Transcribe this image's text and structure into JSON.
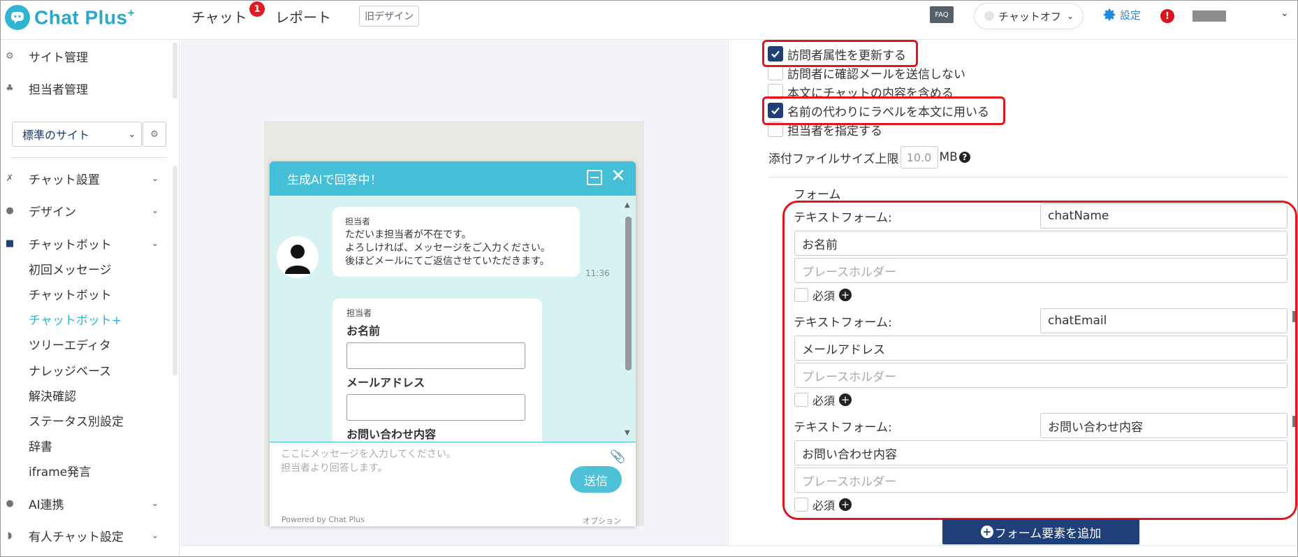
{
  "header": {
    "logo_text": "Chat Plus",
    "logo_sup": "+",
    "nav_chat": "チャット",
    "nav_chat_badge": "1",
    "nav_report": "レポート",
    "old_design": "旧デザイン",
    "faq": "FAQ",
    "chat_status": "チャットオフ",
    "settings": "設定",
    "alert": "!"
  },
  "sidebar": {
    "site_manage": "サイト管理",
    "staff_manage": "担当者管理",
    "site_select": "標準のサイト",
    "sections": {
      "chat_setup": "チャット設置",
      "design": "デザイン",
      "chatbot": "チャットボット",
      "ai": "AI連携",
      "manned": "有人チャット設定"
    },
    "sub": {
      "first_message": "初回メッセージ",
      "chatbot": "チャットボット",
      "chatbot_plus": "チャットボット+",
      "tree_editor": "ツリーエディタ",
      "knowledge": "ナレッジベース",
      "resolution": "解決確認",
      "status_settings": "ステータス別設定",
      "dictionary": "辞書",
      "iframe": "iframe発言"
    }
  },
  "widget": {
    "title": "生成AIで回答中！",
    "bubble1_name": "担当者",
    "bubble1_msg": "ただいま担当者が不在です。\nよろしければ、メッセージをご入力ください。\n後ほどメールにてご返信させていただきます。",
    "bubble1_time": "11:36",
    "bubble2_name": "担当者",
    "field_name": "お名前",
    "field_email": "メールアドレス",
    "field_inquiry": "お問い合わせ内容",
    "input_placeholder": "ここにメッセージを入力してください。\n担当者より回答します。",
    "send": "送信",
    "powered": "Powered by Chat Plus",
    "option": "オプション"
  },
  "settings_panel": {
    "cb_update_attr": "訪問者属性を更新する",
    "cb_no_confirm_mail": "訪問者に確認メールを送信しない",
    "cb_include_chat": "本文にチャットの内容を含める",
    "cb_use_label": "名前の代わりにラベルを本文に用いる",
    "cb_assign_staff": "担当者を指定する",
    "checked": {
      "update_attr": true,
      "no_confirm_mail": false,
      "include_chat": false,
      "use_label": true,
      "assign_staff": false
    },
    "filesize_label": "添付ファイルサイズ上限",
    "filesize_value": "10.0",
    "filesize_unit": "MB",
    "form_title": "フォーム",
    "forms": [
      {
        "type_label": "テキストフォーム:",
        "key": "chatName",
        "label": "お名前",
        "placeholder": "プレースホルダー",
        "required": "必須"
      },
      {
        "type_label": "テキストフォーム:",
        "key": "chatEmail",
        "label": "メールアドレス",
        "placeholder": "プレースホルダー",
        "required": "必須"
      },
      {
        "type_label": "テキストフォーム:",
        "key": "お問い合わせ内容",
        "label": "お問い合わせ内容",
        "placeholder": "プレースホルダー",
        "required": "必須"
      }
    ],
    "add_element": "フォーム要素を追加"
  },
  "colors": {
    "accent": "#2aa8c7",
    "widget_header": "#45bfd8",
    "primary_button": "#1e3f78",
    "highlight": "#e2141c",
    "badge": "#e21a22"
  }
}
